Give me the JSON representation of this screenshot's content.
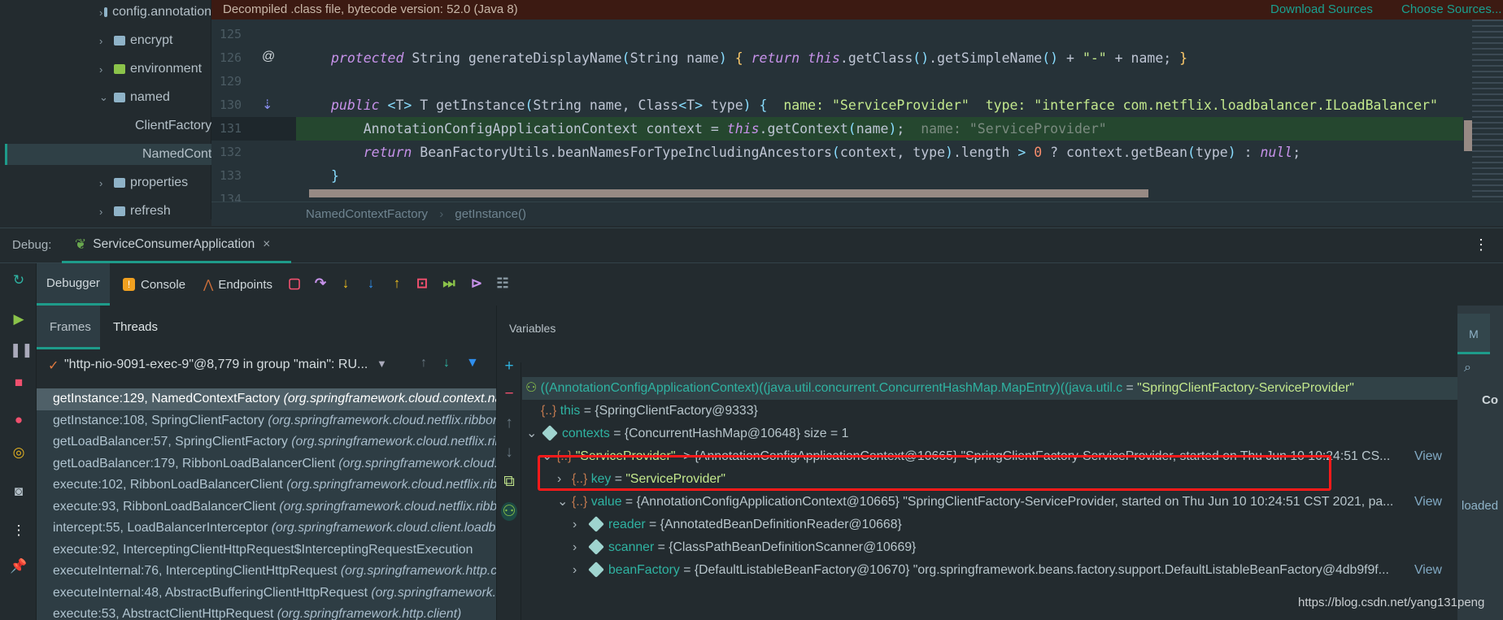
{
  "project_tree": [
    {
      "label": "config.annotation",
      "chev": "›",
      "folder": "plain",
      "indent": 0
    },
    {
      "label": "encrypt",
      "chev": "›",
      "folder": "plain",
      "indent": 0
    },
    {
      "label": "environment",
      "chev": "›",
      "folder": "green",
      "indent": 0
    },
    {
      "label": "named",
      "chev": "⌄",
      "folder": "plain",
      "indent": 0
    },
    {
      "label": "ClientFactory",
      "chev": "",
      "folder": "class",
      "indent": 1
    },
    {
      "label": "NamedContextFactory",
      "chev": "",
      "folder": "class",
      "indent": 1,
      "selected": true
    },
    {
      "label": "properties",
      "chev": "›",
      "folder": "plain",
      "indent": 0
    },
    {
      "label": "refresh",
      "chev": "›",
      "folder": "plain",
      "indent": 0
    }
  ],
  "banner": {
    "text": "Decompiled .class file, bytecode version: 52.0 (Java 8)",
    "download": "Download Sources",
    "choose": "Choose Sources..."
  },
  "editor": {
    "lines": [
      {
        "num": "125",
        "tokens": []
      },
      {
        "num": "126",
        "gutter": "@",
        "tokens": [
          [
            "kw",
            "protected"
          ],
          [
            "id",
            " String generateDisplayName"
          ],
          [
            "p",
            "("
          ],
          [
            "id",
            "String name"
          ],
          [
            "p",
            ")"
          ],
          [
            "id",
            " "
          ],
          [
            "br",
            "{"
          ],
          [
            "id",
            " "
          ],
          [
            "kw",
            "return"
          ],
          [
            "id",
            " "
          ],
          [
            "kw",
            "this"
          ],
          [
            "id",
            ".getClass"
          ],
          [
            "p",
            "()"
          ],
          [
            "id",
            ".getSimpleName"
          ],
          [
            "p",
            "()"
          ],
          [
            "id",
            " + "
          ],
          [
            "str",
            "\"-\""
          ],
          [
            "id",
            " + name; "
          ],
          [
            "br",
            "}"
          ]
        ]
      },
      {
        "num": "129",
        "tokens": []
      },
      {
        "num": "130",
        "gutter": "⇣",
        "tokens": [
          [
            "kw",
            "public"
          ],
          [
            "id",
            " "
          ],
          [
            "p",
            "<"
          ],
          [
            "id",
            "T"
          ],
          [
            "p",
            ">"
          ],
          [
            "id",
            " T getInstance"
          ],
          [
            "p",
            "("
          ],
          [
            "id",
            "String name, Class"
          ],
          [
            "p",
            "<"
          ],
          [
            "id",
            "T"
          ],
          [
            "p",
            ">"
          ],
          [
            "id",
            " type"
          ],
          [
            "p",
            ")"
          ],
          [
            "id",
            " "
          ],
          [
            "p",
            "{"
          ],
          [
            "hint",
            "  name: \"ServiceProvider\"  type: \"interface com.netflix.loadbalancer.ILoadBalancer\""
          ]
        ]
      },
      {
        "num": "131",
        "highlight": true,
        "tokens": [
          [
            "id",
            "    AnnotationConfigApplicationContext context = "
          ],
          [
            "kw",
            "this"
          ],
          [
            "id",
            ".getContext"
          ],
          [
            "p",
            "("
          ],
          [
            "id",
            "name"
          ],
          [
            "p",
            ")"
          ],
          [
            "id",
            ";"
          ],
          [
            "hintg",
            "  name: \"ServiceProvider\""
          ]
        ]
      },
      {
        "num": "132",
        "tokens": [
          [
            "id",
            "    "
          ],
          [
            "kw",
            "return"
          ],
          [
            "id",
            " BeanFactoryUtils.beanNamesForTypeIncludingAncestors"
          ],
          [
            "p",
            "("
          ],
          [
            "id",
            "context, type"
          ],
          [
            "p",
            ")"
          ],
          [
            "id",
            ".length "
          ],
          [
            "p",
            ">"
          ],
          [
            "id",
            " "
          ],
          [
            "num",
            "0"
          ],
          [
            "id",
            " ? context.getBean"
          ],
          [
            "p",
            "("
          ],
          [
            "id",
            "type"
          ],
          [
            "p",
            ")"
          ],
          [
            "id",
            " : "
          ],
          [
            "kw",
            "null"
          ],
          [
            "id",
            ";"
          ]
        ]
      },
      {
        "num": "133",
        "tokens": [
          [
            "p",
            "}"
          ]
        ]
      },
      {
        "num": "134",
        "tokens": []
      }
    ]
  },
  "breadcrumb": [
    "NamedContextFactory",
    "getInstance()"
  ],
  "debug": {
    "label": "Debug:",
    "tab": "ServiceConsumerApplication",
    "close": "×"
  },
  "toolbar": {
    "debugger": "Debugger",
    "console": "Console",
    "endpoints": "Endpoints"
  },
  "subtabs": {
    "frames": "Frames",
    "threads": "Threads"
  },
  "thread": {
    "check": "✓",
    "label": "\"http-nio-9091-exec-9\"@8,779 in group \"main\": RU..."
  },
  "frames": [
    {
      "m": "getInstance:129, NamedContextFactory ",
      "p": "(org.springframework.cloud.context.named)",
      "sel": true
    },
    {
      "m": "getInstance:108, SpringClientFactory ",
      "p": "(org.springframework.cloud.netflix.ribbon)"
    },
    {
      "m": "getLoadBalancer:57, SpringClientFactory ",
      "p": "(org.springframework.cloud.netflix.ribbon)"
    },
    {
      "m": "getLoadBalancer:179, RibbonLoadBalancerClient ",
      "p": "(org.springframework.cloud.netflix.ribbon)"
    },
    {
      "m": "execute:102, RibbonLoadBalancerClient ",
      "p": "(org.springframework.cloud.netflix.ribbon)"
    },
    {
      "m": "execute:93, RibbonLoadBalancerClient ",
      "p": "(org.springframework.cloud.netflix.ribbon)"
    },
    {
      "m": "intercept:55, LoadBalancerInterceptor ",
      "p": "(org.springframework.cloud.client.loadbalancer)"
    },
    {
      "m": "execute:92, InterceptingClientHttpRequest$InterceptingRequestExecution ",
      "p": ""
    },
    {
      "m": "executeInternal:76, InterceptingClientHttpRequest ",
      "p": "(org.springframework.http.client)"
    },
    {
      "m": "executeInternal:48, AbstractBufferingClientHttpRequest ",
      "p": "(org.springframework.http.client)"
    },
    {
      "m": "execute:53, AbstractClientHttpRequest ",
      "p": "(org.springframework.http.client)"
    }
  ],
  "variables": {
    "header": "Variables",
    "watch": {
      "expr": "((AnnotationConfigApplicationContext)((java.util.concurrent.ConcurrentHashMap.MapEntry)((java.util.c",
      "value": "\"SpringClientFactory-ServiceProvider\""
    },
    "rows": [
      {
        "depth": 0,
        "chev": "",
        "icon": "obj",
        "name": "this",
        "value": " = {SpringClientFactory@9333}"
      },
      {
        "depth": 0,
        "chev": "⌄",
        "icon": "field",
        "name": "contexts",
        "value": " = {ConcurrentHashMap@10648}  size = 1"
      },
      {
        "depth": 1,
        "chev": "⌄",
        "icon": "obj",
        "str": "\"ServiceProvider\"",
        "value": " -> {AnnotationConfigApplicationContext@10665} \"SpringClientFactory-ServiceProvider, started on Thu Jun 10 10:24:51 CS...",
        "view": "View"
      },
      {
        "depth": 2,
        "chev": "›",
        "icon": "obj",
        "name": "key",
        "value": " = ",
        "str2": "\"ServiceProvider\""
      },
      {
        "depth": 2,
        "chev": "⌄",
        "icon": "obj",
        "name": "value",
        "value": " = {AnnotationConfigApplicationContext@10665} \"SpringClientFactory-ServiceProvider, started on Thu Jun 10 10:24:51 CST 2021, pa...",
        "view": "View"
      },
      {
        "depth": 3,
        "chev": "›",
        "icon": "field",
        "name": "reader",
        "value": " = {AnnotatedBeanDefinitionReader@10668}"
      },
      {
        "depth": 3,
        "chev": "›",
        "icon": "field",
        "name": "scanner",
        "value": " = {ClassPathBeanDefinitionScanner@10669}"
      },
      {
        "depth": 3,
        "chev": "›",
        "icon": "field",
        "name": "beanFactory",
        "value": " = {DefaultListableBeanFactory@10670} \"org.springframework.beans.factory.support.DefaultListableBeanFactory@4db9f9f...",
        "view": "View"
      }
    ]
  },
  "right_panel": {
    "tab": "M",
    "snippet1": "Co",
    "snippet2": "loaded"
  },
  "watermark": "https://blog.csdn.net/yang131peng",
  "colors": {
    "accent": "#1e9b8a",
    "highlight_line": "#25472f",
    "annotation_box": "#ff1a1a",
    "banner": "#3c1a12"
  }
}
